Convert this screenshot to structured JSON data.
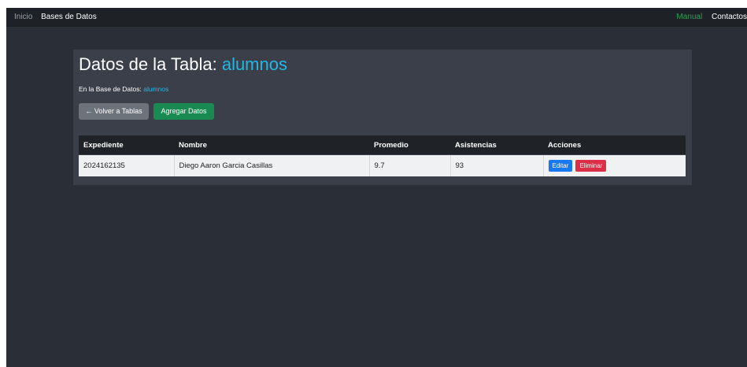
{
  "nav": {
    "left": [
      "Inicio",
      "Bases de Datos"
    ],
    "right": [
      "Manual",
      "Contactos"
    ]
  },
  "page": {
    "title_prefix": "Datos de la Tabla: ",
    "table_name": "alumnos",
    "db_label": "En la Base de Datos: ",
    "db_name": "alumnos"
  },
  "buttons": {
    "back": "← Volver a Tablas",
    "add": "Agregar Datos"
  },
  "table": {
    "headers": [
      "Expediente",
      "Nombre",
      "Promedio",
      "Asistencias",
      "Acciones"
    ],
    "rows": [
      {
        "expediente": "2024162135",
        "nombre": "Diego Aaron Garcia Casillas",
        "promedio": "9.7",
        "asistencias": "93"
      }
    ],
    "actions": {
      "edit": "Editar",
      "delete": "Eliminar"
    }
  },
  "colors": {
    "accent": "#22b8e6",
    "success": "#1a8a53",
    "primary": "#1878f0",
    "danger": "#dc2f45",
    "secondary": "#6c737b"
  }
}
